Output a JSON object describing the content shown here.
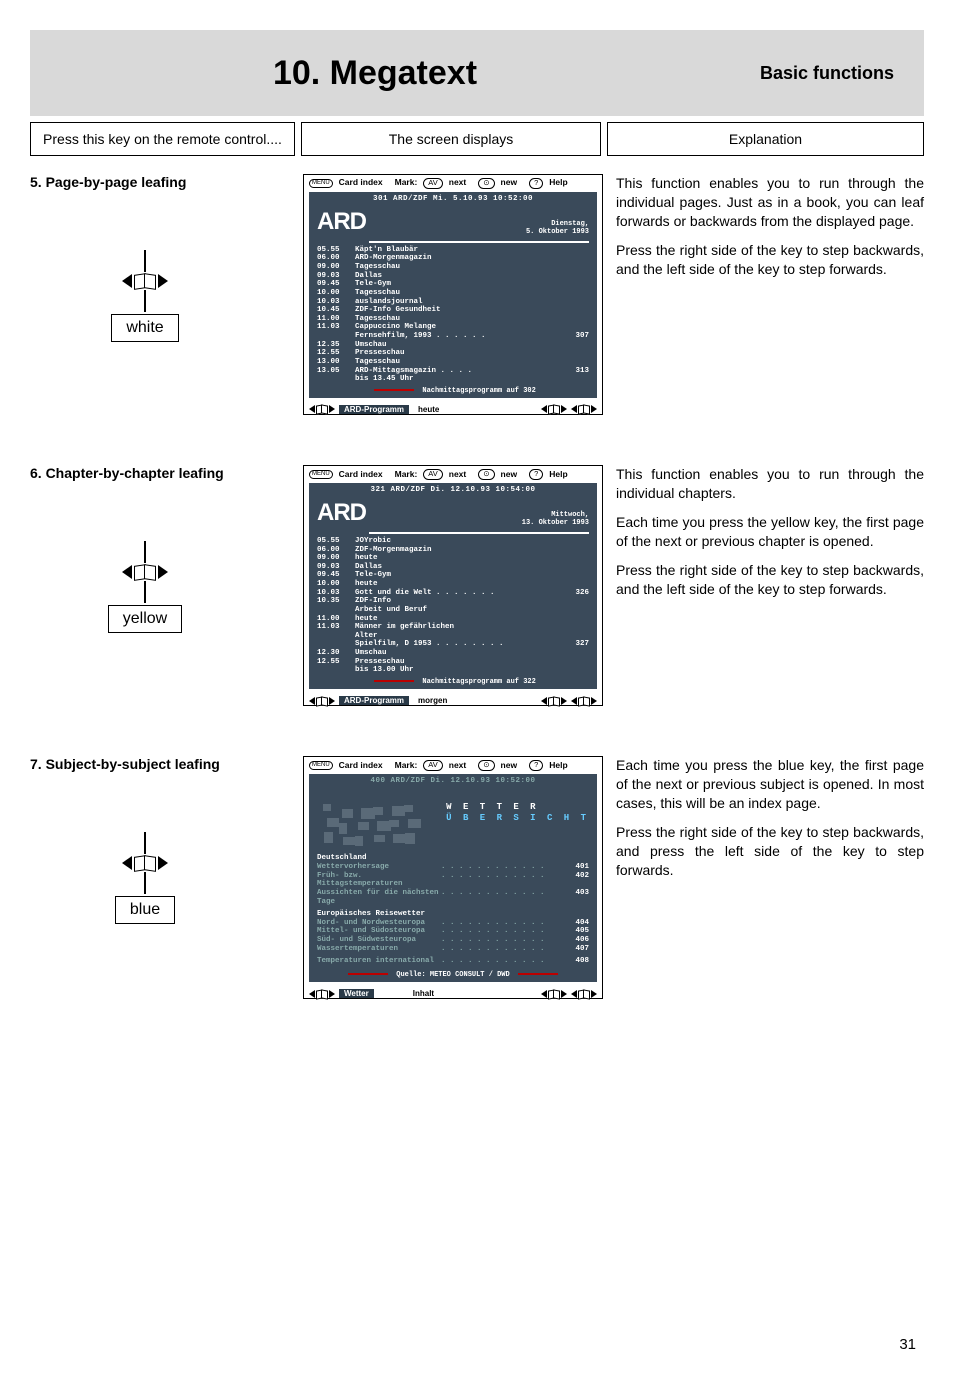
{
  "header": {
    "title": "10. Megatext",
    "subtitle": "Basic functions"
  },
  "top": {
    "col1": "Press this key on the remote control....",
    "col2": "The screen displays",
    "col3": "Explanation"
  },
  "sections": [
    {
      "heading": "5. Page-by-page leafing",
      "key_color": "white",
      "explanation": [
        "This function enables you to run through the individual pages. Just as in a book, you can leaf forwards or backwards from the displayed page.",
        "Press the right side of the key to step backwards, and the left side of the key to step forwards."
      ],
      "screen": {
        "menubar": {
          "menu": "MENU",
          "cardindex": "Card index",
          "mark_pill": "AV",
          "mark": "Mark:",
          "next": "next",
          "new_pill": "⊙",
          "new": "new",
          "help_pill": "?",
          "help": "Help"
        },
        "header_line": "301  ARD/ZDF  Mi.  5.10.93  10:52:00",
        "logo": "ARD",
        "date": "Dienstag,\n5. Oktober 1993",
        "rows": [
          {
            "t": "05.55",
            "p": "Käpt'n Blaubär",
            "n": ""
          },
          {
            "t": "06.00",
            "p": "ARD-Morgenmagazin",
            "n": ""
          },
          {
            "t": "09.00",
            "p": "Tagesschau",
            "n": ""
          },
          {
            "t": "09.03",
            "p": "Dallas",
            "n": ""
          },
          {
            "t": "09.45",
            "p": "Tele-Gym",
            "n": ""
          },
          {
            "t": "10.00",
            "p": "Tagesschau",
            "n": ""
          },
          {
            "t": "10.03",
            "p": "auslandsjournal",
            "n": ""
          },
          {
            "t": "10.45",
            "p": "ZDF-Info Gesundheit",
            "n": ""
          },
          {
            "t": "11.00",
            "p": "Tagesschau",
            "n": ""
          },
          {
            "t": "11.03",
            "p": "Cappuccino Melange",
            "n": ""
          },
          {
            "t": "",
            "p": "Fernsehfilm, 1993 . . . . . .",
            "n": "307"
          },
          {
            "t": "12.35",
            "p": "Umschau",
            "n": ""
          },
          {
            "t": "12.55",
            "p": "Presseschau",
            "n": ""
          },
          {
            "t": "13.00",
            "p": "Tagesschau",
            "n": ""
          },
          {
            "t": "13.05",
            "p": "ARD-Mittagsmagazin . . . .",
            "n": "313"
          },
          {
            "t": "",
            "p": "bis 13.45 Uhr",
            "n": ""
          }
        ],
        "footer_note": "Nachmittagsprogramm auf 302",
        "bottom": {
          "label": "ARD-Programm",
          "chip": "heute"
        }
      }
    },
    {
      "heading": "6. Chapter-by-chapter leafing",
      "key_color": "yellow",
      "explanation": [
        "This function enables you to run through the individual chapters.",
        "Each time you press the yellow key, the first page of the next or previous chapter is opened.",
        "Press the right side of the key to step backwards, and the left side of the key to step forwards."
      ],
      "screen": {
        "menubar": {
          "menu": "MENU",
          "cardindex": "Card index",
          "mark_pill": "AV",
          "mark": "Mark:",
          "next": "next",
          "new_pill": "⊙",
          "new": "new",
          "help_pill": "?",
          "help": "Help"
        },
        "header_line": "321  ARD/ZDF  Di.  12.10.93  10:54:00",
        "logo": "ARD",
        "date": "Mittwoch,\n13. Oktober 1993",
        "rows": [
          {
            "t": "05.55",
            "p": "JOYrobic",
            "n": ""
          },
          {
            "t": "06.00",
            "p": "ZDF-Morgenmagazin",
            "n": ""
          },
          {
            "t": "09.00",
            "p": "heute",
            "n": ""
          },
          {
            "t": "09.03",
            "p": "Dallas",
            "n": ""
          },
          {
            "t": "09.45",
            "p": "Tele-Gym",
            "n": ""
          },
          {
            "t": "10.00",
            "p": "heute",
            "n": ""
          },
          {
            "t": "10.03",
            "p": "Gott und die Welt  . . . . . . .",
            "n": "326"
          },
          {
            "t": "10.35",
            "p": "ZDF-Info",
            "n": ""
          },
          {
            "t": "",
            "p": "Arbeit und Beruf",
            "n": ""
          },
          {
            "t": "11.00",
            "p": "heute",
            "n": ""
          },
          {
            "t": "11.03",
            "p": "Männer im gefährlichen",
            "n": ""
          },
          {
            "t": "",
            "p": "Alter",
            "n": ""
          },
          {
            "t": "",
            "p": "Spielfilm, D 1953 . . . . . . . .",
            "n": "327"
          },
          {
            "t": "12.30",
            "p": "Umschau",
            "n": ""
          },
          {
            "t": "12.55",
            "p": "Presseschau",
            "n": ""
          },
          {
            "t": "",
            "p": "bis 13.00 Uhr",
            "n": ""
          }
        ],
        "footer_note": "Nachmittagsprogramm auf 322",
        "bottom": {
          "label": "ARD-Programm",
          "chip": "morgen"
        }
      }
    },
    {
      "heading": "7. Subject-by-subject leafing",
      "key_color": "blue",
      "explanation": [
        "Each time you press the blue key, the first page of the next or previous subject is opened. In most cases,  this will be an index page.",
        "Press the right side of the key to step backwards, and press the left side of the key to step forwards."
      ],
      "screen": {
        "menubar": {
          "menu": "MENU",
          "cardindex": "Card index",
          "mark_pill": "AV",
          "mark": "Mark:",
          "next": "next",
          "new_pill": "⊙",
          "new": "new",
          "help_pill": "?",
          "help": "Help"
        },
        "header_line": "400  ARD/ZDF  Di.  12.10.93  10:52:00",
        "wetter_title1": "W E T T E R",
        "wetter_title2": "Ü B E R S I C H T",
        "groups": [
          {
            "title": "Deutschland",
            "rows": [
              {
                "l": "Wettervorhersage",
                "n": "401"
              },
              {
                "l": "Früh- bzw. Mittagstemperaturen",
                "n": "402"
              },
              {
                "l": "Aussichten für die nächsten Tage",
                "n": "403"
              }
            ]
          },
          {
            "title": "Europäisches Reisewetter",
            "rows": [
              {
                "l": "Nord- und Nordwesteuropa",
                "n": "404"
              },
              {
                "l": "Mittel- und Südosteuropa",
                "n": "405"
              },
              {
                "l": "Süd- und Südwesteuropa",
                "n": "406"
              },
              {
                "l": "Wassertemperaturen",
                "n": "407"
              }
            ]
          },
          {
            "title": "",
            "rows": [
              {
                "l": "Temperaturen international",
                "n": "408"
              }
            ]
          }
        ],
        "footer_note": "Quelle: METEO CONSULT / DWD",
        "bottom": {
          "label": "Wetter",
          "chip": "Inhalt"
        }
      }
    }
  ],
  "page_number": "31"
}
